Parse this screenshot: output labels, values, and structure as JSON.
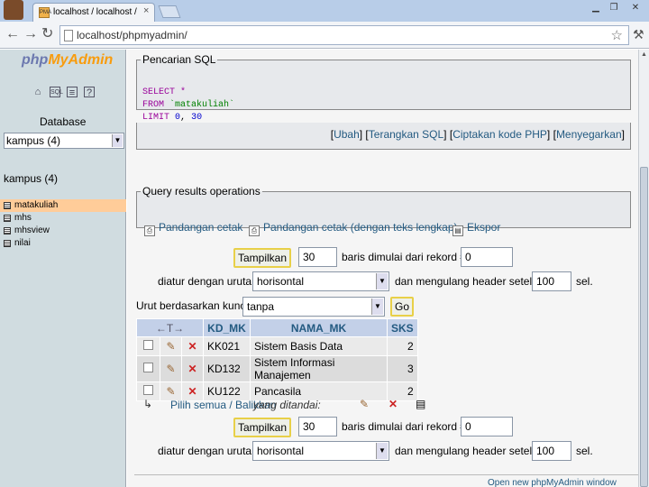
{
  "browser": {
    "tab_title": "localhost / localhost / kampus",
    "tab_favicon": "PMA",
    "url": "localhost/phpmyadmin/",
    "window_controls": [
      "minimize-icon",
      "restore-icon",
      "close-icon"
    ]
  },
  "sidebar": {
    "logo_php": "php",
    "logo_myadmin": "MyAdmin",
    "nav_icons": [
      "home-icon",
      "sql-query-icon",
      "docs-icon",
      "help-icon"
    ],
    "database_label": "Database",
    "database_select_value": "kampus (4)",
    "db_heading": "kampus (4)",
    "tables": [
      "matakuliah",
      "mhs",
      "mhsview",
      "nilai"
    ],
    "active_table": "matakuliah"
  },
  "sql_box": {
    "legend": "Pencarian SQL",
    "line1_kw": "SELECT",
    "line1_rest": " *",
    "line2_kw": "FROM",
    "line2_rest": " `matakuliah`",
    "line3_kw": "LIMIT",
    "line3_num1": "0",
    "line3_sep": ", ",
    "line3_num2": "30",
    "links": [
      "Ubah",
      "Terangkan SQL",
      "Ciptakan kode PHP",
      "Menyegarkan"
    ]
  },
  "qro": {
    "legend": "Query results operations",
    "print_view": "Pandangan cetak",
    "print_view_full": "Pandangan cetak (dengan teks lengkap)",
    "export": "Ekspor"
  },
  "nav_form": {
    "show_button": "Tampilkan",
    "rows_value": "30",
    "start_label": "baris dimulai dari rekord #",
    "start_value": "0",
    "mode_label": "diatur dengan urutan",
    "mode_value": "horisontal",
    "repeat_label": "dan mengulang header setelah",
    "repeat_value": "100",
    "cells_label": "sel."
  },
  "sort": {
    "label": "Urut berdasarkan kunci",
    "value": "tanpa",
    "go_button": "Go"
  },
  "table": {
    "columns": [
      "KD_MK",
      "NAMA_MK",
      "SKS"
    ],
    "rows": [
      {
        "kd": "KK021",
        "nama": "Sistem Basis Data",
        "sks": "2"
      },
      {
        "kd": "KD132",
        "nama": "Sistem Informasi Manajemen",
        "sks": "3"
      },
      {
        "kd": "KU122",
        "nama": "Pancasila",
        "sks": "2"
      }
    ]
  },
  "checkall": {
    "text": "Pilih semua / Balikkan",
    "with_selected": "yang ditandai:"
  },
  "footer": {
    "print_link": "Open new phpMyAdmin window"
  }
}
